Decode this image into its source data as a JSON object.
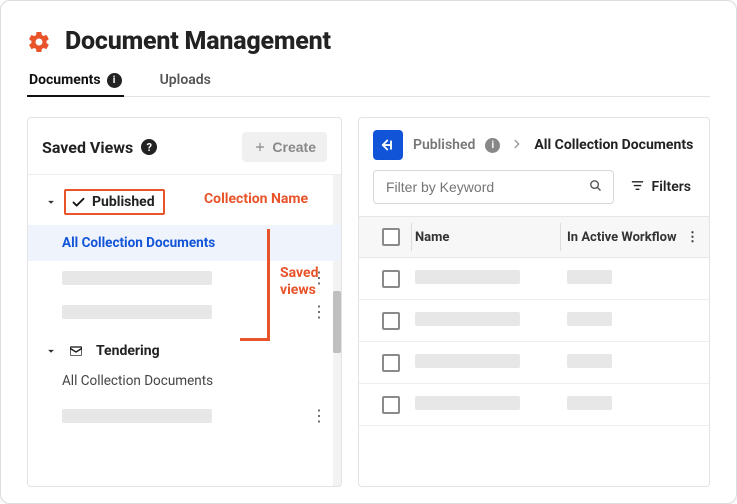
{
  "header": {
    "title": "Document Management"
  },
  "tabs": {
    "documents": "Documents",
    "uploads": "Uploads"
  },
  "left": {
    "title": "Saved Views",
    "create_label": "Create",
    "collections": {
      "published": {
        "name": "Published",
        "view_all": "All Collection Documents"
      },
      "tendering": {
        "name": "Tendering",
        "view_all": "All Collection Documents"
      }
    },
    "annotations": {
      "collection_name": "Collection Name",
      "saved_views_l1": "Saved",
      "saved_views_l2": "views"
    }
  },
  "right": {
    "breadcrumb": {
      "parent": "Published",
      "current": "All Collection Documents"
    },
    "search_placeholder": "Filter by Keyword",
    "filters_label": "Filters",
    "columns": {
      "name": "Name",
      "workflow": "In Active Workflow"
    }
  }
}
